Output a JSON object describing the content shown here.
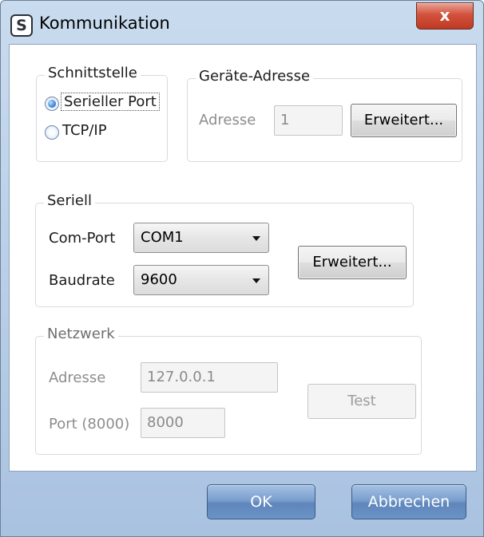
{
  "window": {
    "title": "Kommunikation",
    "app_icon_glyph": "S",
    "close_glyph": "x"
  },
  "schnittstelle": {
    "legend": "Schnittstelle",
    "options": [
      {
        "label": "Serieller Port",
        "checked": true
      },
      {
        "label": "TCP/IP",
        "checked": false
      }
    ]
  },
  "geraete_adresse": {
    "legend": "Geräte-Adresse",
    "address_label": "Adresse",
    "address_value": "1",
    "advanced_button": "Erweitert..."
  },
  "seriell": {
    "legend": "Seriell",
    "com_port_label": "Com-Port",
    "com_port_value": "COM1",
    "baudrate_label": "Baudrate",
    "baudrate_value": "9600",
    "advanced_button": "Erweitert..."
  },
  "netzwerk": {
    "legend": "Netzwerk",
    "address_label": "Adresse",
    "address_value": "127.0.0.1",
    "port_label": "Port (8000)",
    "port_value": "8000",
    "test_button": "Test"
  },
  "footer": {
    "ok_button": "OK",
    "cancel_button": "Abbrechen"
  },
  "colors": {
    "frame": "#b7cde6",
    "close_button": "#c8432c",
    "primary_button": "#6f95c7"
  }
}
